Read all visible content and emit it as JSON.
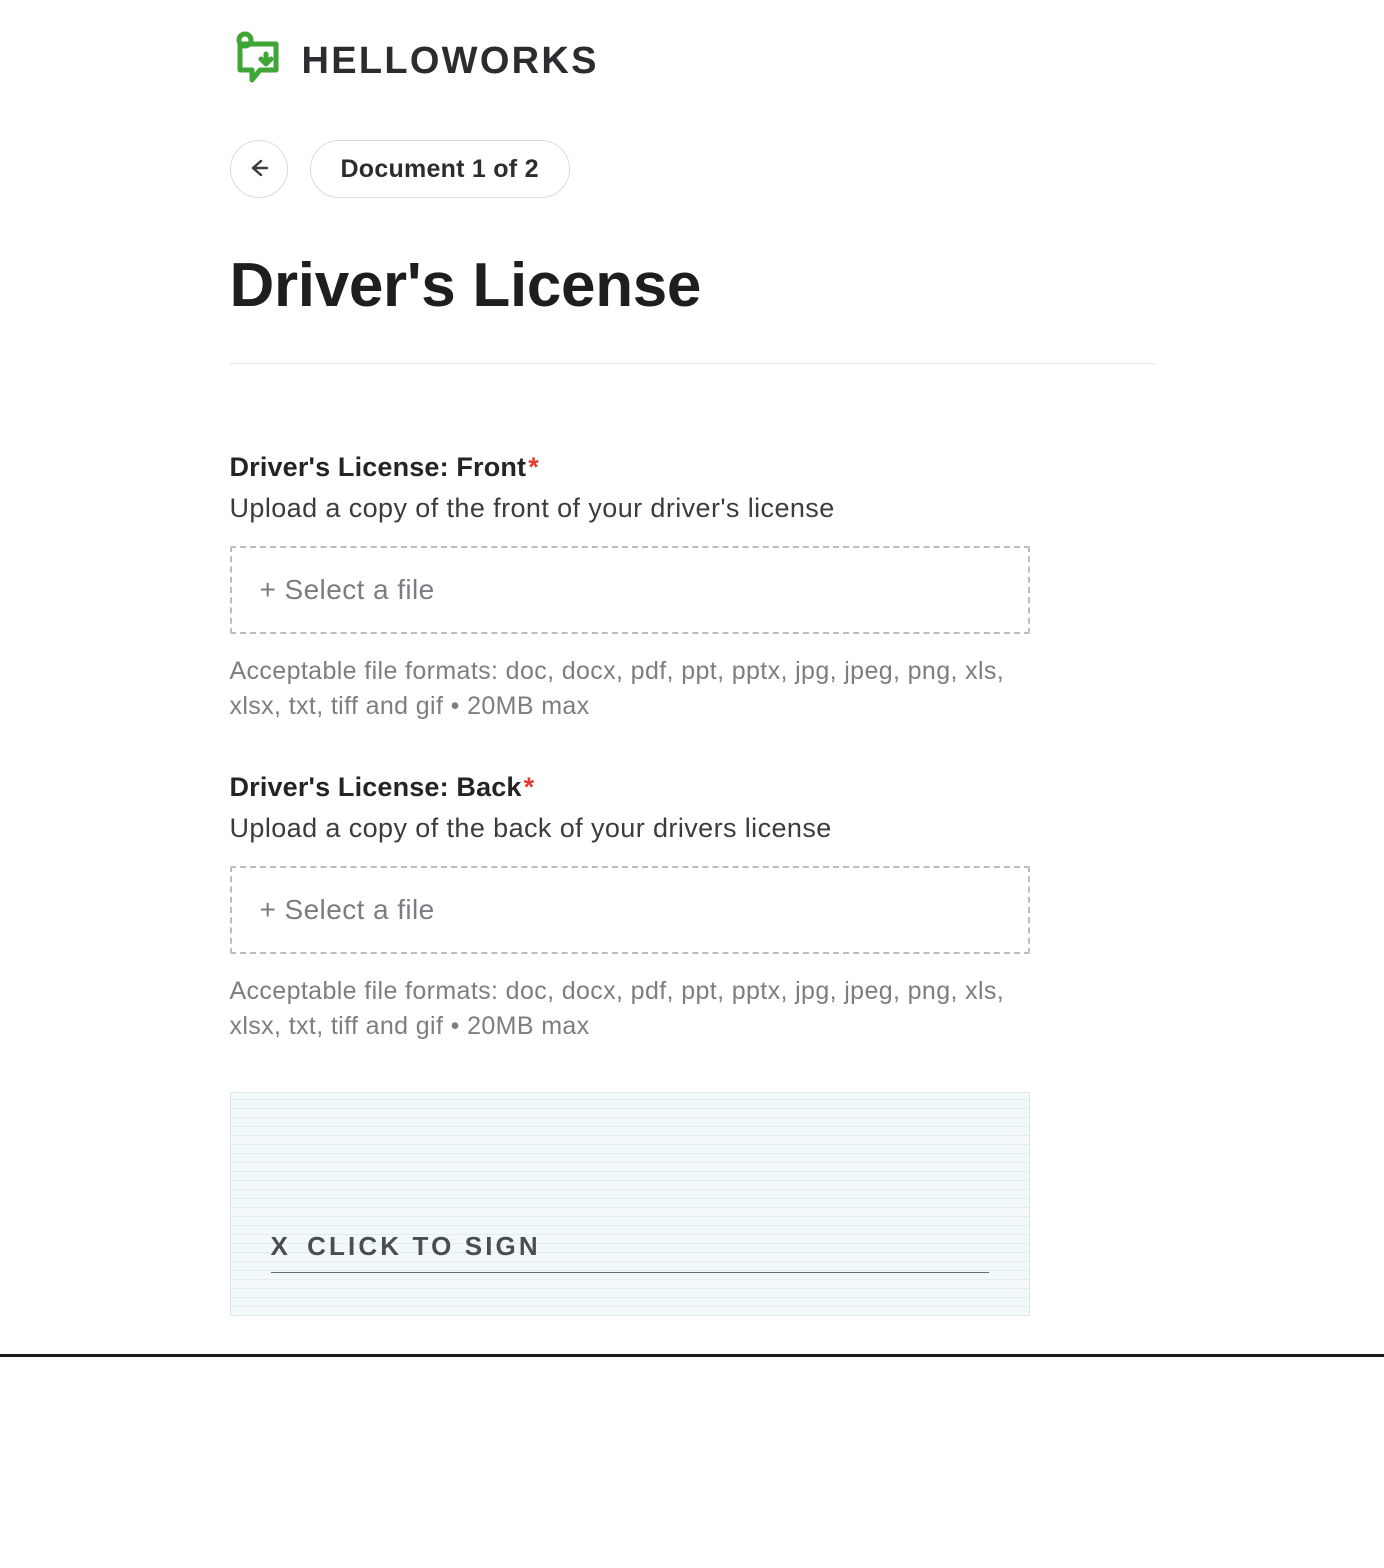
{
  "brand": {
    "name": "HELLOWORKS"
  },
  "nav": {
    "document_indicator": "Document 1 of 2"
  },
  "title": "Driver's License",
  "fields": {
    "front": {
      "label": "Driver's License: Front",
      "required_mark": "*",
      "description": "Upload a copy of the front of your driver's license",
      "select_label": "+ Select a file",
      "hint": "Acceptable file formats: doc, docx, pdf, ppt, pptx, jpg, jpeg, png, xls, xlsx, txt, tiff and gif • 20MB max"
    },
    "back": {
      "label": "Driver's License: Back",
      "required_mark": "*",
      "description": "Upload a copy of the back of your drivers license",
      "select_label": "+ Select a file",
      "hint": "Acceptable file formats: doc, docx, pdf, ppt, pptx, jpg, jpeg, png, xls, xlsx, txt, tiff and gif • 20MB max"
    }
  },
  "signature": {
    "x": "X",
    "cta": "CLICK TO SIGN"
  }
}
